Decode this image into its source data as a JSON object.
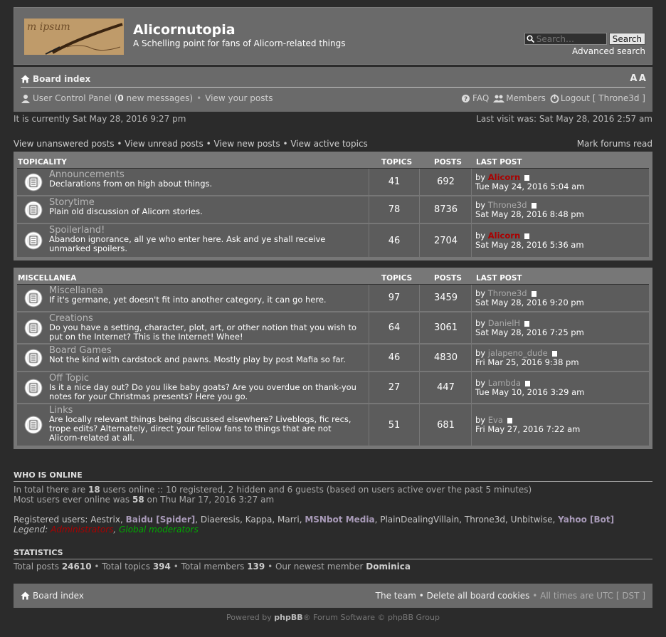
{
  "site": {
    "title": "Alicornutopia",
    "description": "A Schelling point for fans of Alicorn-related things"
  },
  "search": {
    "placeholder": "Search…",
    "button": "Search",
    "advanced": "Advanced search"
  },
  "nav": {
    "board_index": "Board index",
    "font_change": "A A",
    "ucp": "User Control Panel",
    "new_messages_count": "0",
    "new_messages_suffix": "new messages",
    "view_posts": "View your posts",
    "faq": "FAQ",
    "members": "Members",
    "logout": "Logout [ Throne3d ]"
  },
  "status": {
    "current_time": "It is currently Sat May 28, 2016 9:27 pm",
    "last_visit": "Last visit was: Sat May 28, 2016 2:57 am"
  },
  "links": {
    "unanswered": "View unanswered posts",
    "unread": "View unread posts",
    "new": "View new posts",
    "active": "View active topics",
    "mark_read": "Mark forums read"
  },
  "columns": {
    "topics": "TOPICS",
    "posts": "POSTS",
    "last_post": "LAST POST"
  },
  "categories": [
    {
      "name": "TOPICALITY",
      "forums": [
        {
          "title": "Announcements",
          "desc": "Declarations from on high about things.",
          "topics": "41",
          "posts": "692",
          "by": "Alicorn",
          "admin": true,
          "date": "Tue May 24, 2016 5:04 am"
        },
        {
          "title": "Storytime",
          "desc": "Plain old discussion of Alicorn stories.",
          "topics": "78",
          "posts": "8736",
          "by": "Throne3d",
          "admin": false,
          "date": "Sat May 28, 2016 8:48 pm"
        },
        {
          "title": "Spoilerland!",
          "desc": "Abandon ignorance, all ye who enter here. Ask and ye shall receive unmarked spoilers.",
          "topics": "46",
          "posts": "2704",
          "by": "Alicorn",
          "admin": true,
          "date": "Sat May 28, 2016 5:36 am"
        }
      ]
    },
    {
      "name": "MISCELLANEA",
      "forums": [
        {
          "title": "Miscellanea",
          "desc": "If it's germane, yet doesn't fit into another category, it can go here.",
          "topics": "97",
          "posts": "3459",
          "by": "Throne3d",
          "admin": false,
          "date": "Sat May 28, 2016 9:20 pm"
        },
        {
          "title": "Creations",
          "desc": "Do you have a setting, character, plot, art, or other notion that you wish to put on the Internet? This is the Internet! Whee!",
          "topics": "64",
          "posts": "3061",
          "by": "DanielH",
          "admin": false,
          "date": "Sat May 28, 2016 7:25 pm"
        },
        {
          "title": "Board Games",
          "desc": "Not the kind with cardstock and pawns. Mostly play by post Mafia so far.",
          "topics": "46",
          "posts": "4830",
          "by": "jalapeno_dude",
          "admin": false,
          "date": "Fri Mar 25, 2016 9:38 pm"
        },
        {
          "title": "Off Topic",
          "desc": "Is it a nice day out? Do you like baby goats? Are you overdue on thank-you notes for your Christmas presents? Here you go.",
          "topics": "27",
          "posts": "447",
          "by": "Lambda",
          "admin": false,
          "date": "Tue May 10, 2016 3:29 am"
        },
        {
          "title": "Links",
          "desc": "Are locally relevant things being discussed elsewhere? Liveblogs, fic recs, trope edits? Alternately, direct your fellow fans to things that are not Alicorn-related at all.",
          "topics": "51",
          "posts": "681",
          "by": "Eva",
          "admin": false,
          "date": "Fri May 27, 2016 7:22 am"
        }
      ]
    }
  ],
  "by_label": "by",
  "online": {
    "title": "WHO IS ONLINE",
    "line1_pre": "In total there are ",
    "total": "18",
    "line1_post": " users online :: 10 registered, 2 hidden and 6 guests (based on users active over the past 5 minutes)",
    "line2_pre": "Most users ever online was ",
    "most": "58",
    "line2_post": " on Thu Mar 17, 2016 3:27 am",
    "registered_label": "Registered users: ",
    "users": [
      "Aestrix",
      "Baidu [Spider]",
      "Diaeresis",
      "Kappa",
      "Marri",
      "MSNbot Media",
      "PlainDealingVillain",
      "Throne3d",
      "Unbitwise",
      "Yahoo [Bot]"
    ],
    "legend_label": "Legend: ",
    "legend_admins": "Administrators",
    "legend_mods": "Global moderators"
  },
  "stats": {
    "title": "STATISTICS",
    "posts_label": "Total posts ",
    "posts": "24610",
    "topics_label": "Total topics ",
    "topics": "394",
    "members_label": "Total members ",
    "members": "139",
    "newest_label": "Our newest member ",
    "newest": "Dominica"
  },
  "footer": {
    "board_index": "Board index",
    "team": "The team",
    "delete_cookies": "Delete all board cookies",
    "timezone": "All times are UTC [ DST ]",
    "powered_pre": "Powered by ",
    "phpbb": "phpBB",
    "powered_post": "® Forum Software © phpBB Group"
  }
}
